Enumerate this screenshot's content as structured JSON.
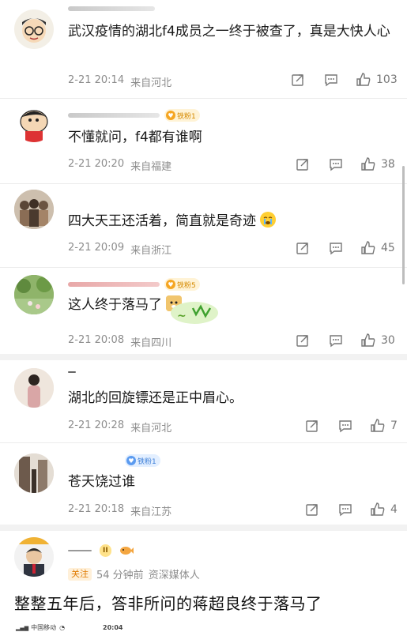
{
  "comments": [
    {
      "text": "武汉疫情的湖北f4成员之一终于被查了，真是大快人心",
      "time": "2-21 20:14",
      "location": "来自河北",
      "likes": "103",
      "avatar_icon": "cartoon-glasses-man-avatar"
    },
    {
      "text": "不懂就问，f4都有谁啊",
      "time": "2-21 20:20",
      "location": "来自福建",
      "likes": "38",
      "fan_badge": "铁粉1",
      "avatar_icon": "crayon-shinchan-avatar"
    },
    {
      "text": "四大天王还活着，简直就是奇迹",
      "time": "2-21 20:09",
      "location": "来自浙江",
      "likes": "45",
      "avatar_icon": "photo-avatar"
    },
    {
      "text": "这人终于落马了",
      "time": "2-21 20:08",
      "location": "来自四川",
      "likes": "30",
      "fan_badge": "铁粉5",
      "avatar_icon": "garden-photo-avatar"
    },
    {
      "text": "湖北的回旋镖还是正中眉心。",
      "time": "2-21 20:28",
      "location": "来自河北",
      "likes": "7",
      "avatar_icon": "portrait-avatar"
    },
    {
      "text": "苍天饶过谁",
      "time": "2-21 20:18",
      "location": "来自江苏",
      "likes": "4",
      "fan_badge": "铁粉1",
      "avatar_icon": "street-photo-avatar"
    }
  ],
  "post": {
    "follow_label": "关注",
    "time": "54 分钟前",
    "source": "资深媒体人",
    "text": "整整五年后，答非所问的蒋超良终于落马了",
    "level_badge": "II"
  },
  "status_bar": {
    "carrier": "中国移动",
    "clock": "20:04"
  },
  "colors": {
    "meta_gray": "#8c8c8c",
    "badge_orange": "#d58a00",
    "badge_blue": "#3d7fd8"
  }
}
